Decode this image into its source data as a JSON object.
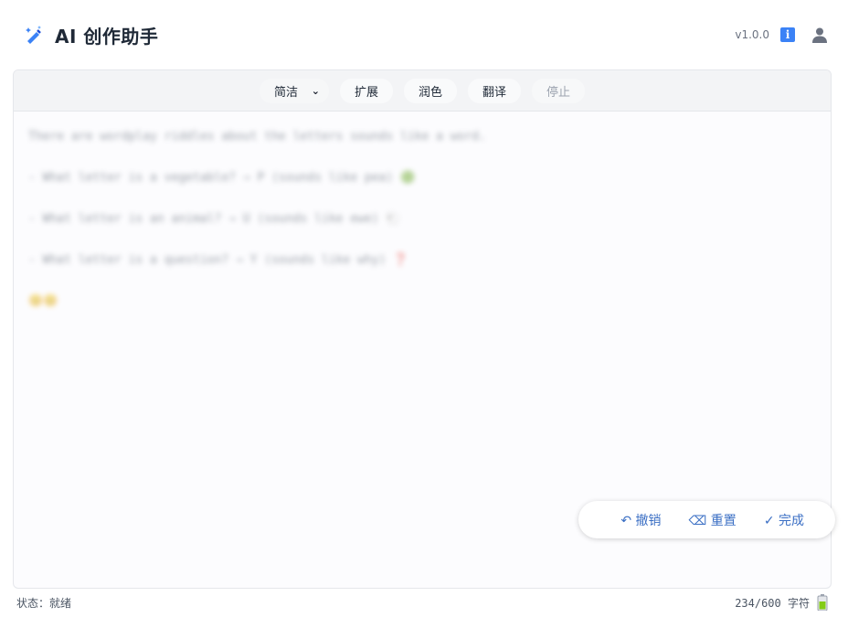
{
  "header": {
    "title": "AI 创作助手",
    "version": "v1.0.0",
    "icons": [
      "magic-wand-icon",
      "info-icon",
      "user-icon"
    ]
  },
  "toolbar": {
    "mode_select": {
      "selected": "简洁"
    },
    "expand_label": "扩展",
    "polish_label": "润色",
    "translate_label": "翻译",
    "stop_label": "停止"
  },
  "content": {
    "lines": [
      "There are wordplay riddles about the letters sounds like a word.",
      "- What letter is a vegetable? → P (sounds like pea) 🟢",
      "- What letter is an animal? → U (sounds like ewe) 🐑",
      "- What letter is a question? → Y (sounds like why) ❓",
      "😊😊"
    ]
  },
  "actions": {
    "undo_label": "↶ 撤销",
    "reset_label": "⌫ 重置",
    "done_label": "✓ 完成"
  },
  "status": {
    "state": "状态：就绪",
    "count": "234/600 字符"
  },
  "colors": {
    "accent": "#3b82f6",
    "action_text": "#3b6fc4",
    "toolbar_bg": "#f3f4f6"
  }
}
